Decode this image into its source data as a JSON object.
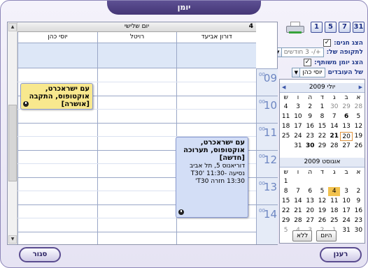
{
  "window": {
    "title": "יומן"
  },
  "view_buttons": [
    "31",
    "7",
    "5",
    "1"
  ],
  "options": {
    "show_holidays_label": "הצג חגים:",
    "show_holidays_checked": true,
    "period_label": "לתקופה של:",
    "period_value": "+/- 3 חודשים",
    "show_shared_label": "הצג יומן משותף:",
    "show_shared_checked": true,
    "employee_label": "של העובדים",
    "employee_value": "יוסי כהן"
  },
  "mini_calendar": {
    "weekday_headers": [
      "א",
      "ב",
      "ג",
      "ד",
      "ה",
      "ו",
      "ש"
    ],
    "months": [
      {
        "title": "יולי 2009",
        "days": [
          [
            {
              "d": "28",
              "m": 1
            },
            {
              "d": "29",
              "m": 1
            },
            {
              "d": "30",
              "m": 1
            },
            {
              "d": "1"
            },
            {
              "d": "2"
            },
            {
              "d": "3"
            },
            {
              "d": "4"
            }
          ],
          [
            {
              "d": "5"
            },
            {
              "d": "6",
              "b": 1
            },
            {
              "d": "7"
            },
            {
              "d": "8"
            },
            {
              "d": "9"
            },
            {
              "d": "10"
            },
            {
              "d": "11"
            }
          ],
          [
            {
              "d": "12"
            },
            {
              "d": "13"
            },
            {
              "d": "14"
            },
            {
              "d": "15"
            },
            {
              "d": "16"
            },
            {
              "d": "17"
            },
            {
              "d": "18"
            }
          ],
          [
            {
              "d": "19"
            },
            {
              "d": "20",
              "r": 1
            },
            {
              "d": "21",
              "b": 1
            },
            {
              "d": "22"
            },
            {
              "d": "23"
            },
            {
              "d": "24"
            },
            {
              "d": "25"
            }
          ],
          [
            {
              "d": "26"
            },
            {
              "d": "27"
            },
            {
              "d": "28"
            },
            {
              "d": "29"
            },
            {
              "d": "30",
              "b": 1
            },
            {
              "d": "31"
            },
            {
              "d": ""
            }
          ]
        ]
      },
      {
        "title": "אוגוסט 2009",
        "days": [
          [
            {
              "d": ""
            },
            {
              "d": ""
            },
            {
              "d": ""
            },
            {
              "d": ""
            },
            {
              "d": ""
            },
            {
              "d": ""
            },
            {
              "d": "1"
            }
          ],
          [
            {
              "d": "2"
            },
            {
              "d": "3"
            },
            {
              "d": "4",
              "s": 1
            },
            {
              "d": "5"
            },
            {
              "d": "6"
            },
            {
              "d": "7"
            },
            {
              "d": "8"
            }
          ],
          [
            {
              "d": "9"
            },
            {
              "d": "10"
            },
            {
              "d": "11"
            },
            {
              "d": "12"
            },
            {
              "d": "13"
            },
            {
              "d": "14"
            },
            {
              "d": "15"
            }
          ],
          [
            {
              "d": "16"
            },
            {
              "d": "17"
            },
            {
              "d": "18"
            },
            {
              "d": "19"
            },
            {
              "d": "20"
            },
            {
              "d": "21"
            },
            {
              "d": "22"
            }
          ],
          [
            {
              "d": "23"
            },
            {
              "d": "24"
            },
            {
              "d": "25"
            },
            {
              "d": "26"
            },
            {
              "d": "27"
            },
            {
              "d": "28"
            },
            {
              "d": "29"
            }
          ],
          [
            {
              "d": "30"
            },
            {
              "d": "31"
            },
            {
              "d": "1",
              "m": 1
            },
            {
              "d": "2",
              "m": 1
            },
            {
              "d": "3",
              "m": 1
            },
            {
              "d": "4",
              "m": 1
            },
            {
              "d": "5",
              "m": 1
            }
          ]
        ]
      }
    ],
    "today_button": "היום",
    "none_button": "ללא"
  },
  "day_view": {
    "day_number": "4",
    "day_name": "יום שלישי",
    "columns": [
      "דורון אביעד",
      "רויטל",
      "יוסי כהן"
    ],
    "hours": [
      "09",
      "10",
      "11",
      "12",
      "13",
      "14"
    ],
    "minutes": "00"
  },
  "appointments": [
    {
      "title": "עם ישראכרט, אוקטופוס, התקבה [אושרה]",
      "desc": "",
      "color": "#f8e88e"
    },
    {
      "title": "עם ישראכרט, אוקטופוס, תערוכה [חדשה]",
      "desc": "דוריאנוס 5, תל אביב נסיעה T30' 11:30-13:30 חזרה T30'",
      "color": "#d3def6"
    }
  ],
  "bottom": {
    "refresh_label": "רענן",
    "close_label": "סגור"
  }
}
